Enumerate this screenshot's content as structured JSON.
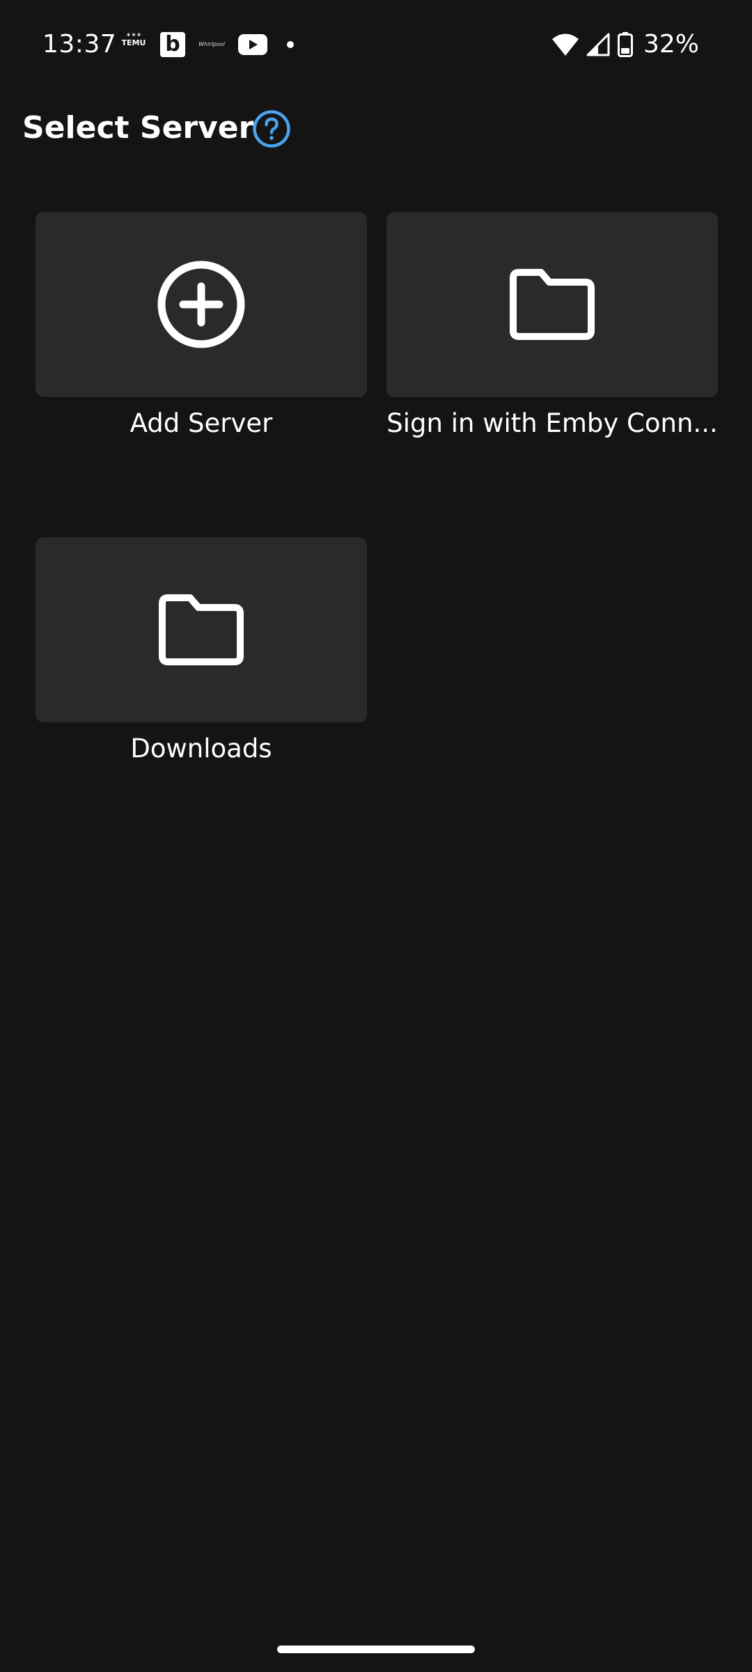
{
  "status_bar": {
    "time": "13:37",
    "notification_icons": [
      "temu-icon",
      "b-icon",
      "whirlpool-icon",
      "youtube-icon",
      "dot-icon"
    ],
    "temu_label_top": "✶✶✶",
    "temu_label": "TEMU",
    "b_label": "b",
    "whirlpool_label": "Whirlpool",
    "system_icons": [
      "wifi-icon",
      "cell-signal-icon",
      "battery-icon"
    ],
    "battery_percent": "32%"
  },
  "header": {
    "title": "Select Server",
    "help_icon": "help-circle-icon",
    "accent_color": "#4aa3f0"
  },
  "tiles": [
    {
      "label": "Add Server",
      "icon": "add-circle-icon"
    },
    {
      "label": "Sign in with Emby Conn...",
      "icon": "folder-icon"
    },
    {
      "label": "Downloads",
      "icon": "folder-icon"
    }
  ],
  "colors": {
    "background": "#141414",
    "tile_background": "#2a2a2a",
    "text": "#ffffff"
  }
}
